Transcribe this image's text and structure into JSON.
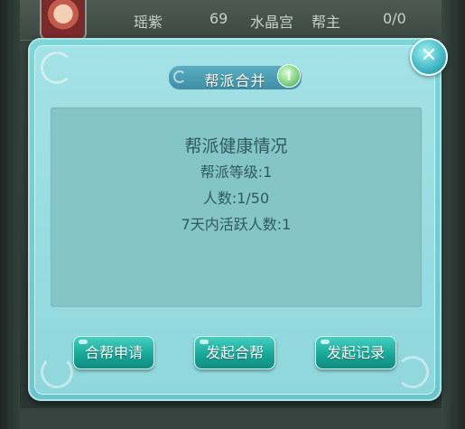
{
  "background": {
    "row": {
      "name": "瑶紫",
      "level": "69",
      "faction": "水晶宫",
      "role": "帮主",
      "count": "0/0"
    }
  },
  "dialog": {
    "title": "帮派合并",
    "help_icon": "help-icon",
    "close_icon": "close-icon",
    "content": {
      "heading": "帮派健康情况",
      "lines": [
        "帮派等级:1",
        "人数:1/50",
        "7天内活跃人数:1"
      ]
    },
    "buttons": {
      "apply_merge": "合帮申请",
      "start_merge": "发起合帮",
      "start_record": "发起记录"
    }
  },
  "colors": {
    "dialog_bg": "#8fd7dc",
    "content_bg": "#84c5c8",
    "button_teal": "#19a898",
    "text_dark": "#2f5a5e"
  }
}
